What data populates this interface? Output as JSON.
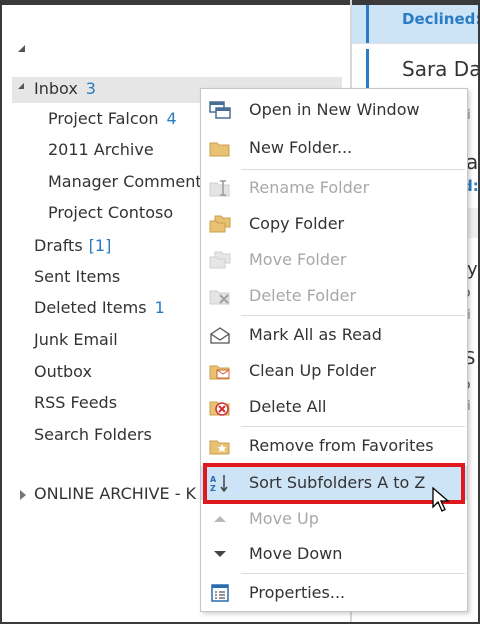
{
  "folder_pane": {
    "inbox": {
      "label": "Inbox",
      "count": "3"
    },
    "subfolders": [
      {
        "label": "Project Falcon",
        "count": "4"
      },
      {
        "label": "2011 Archive",
        "count": ""
      },
      {
        "label": "Manager Comment",
        "count": ""
      },
      {
        "label": "Project Contoso",
        "count": ""
      }
    ],
    "folders": [
      {
        "label": "Drafts",
        "count": "[1]"
      },
      {
        "label": "Sent Items",
        "count": ""
      },
      {
        "label": "Deleted Items",
        "count": "1"
      },
      {
        "label": "Junk Email",
        "count": ""
      },
      {
        "label": "Outbox",
        "count": ""
      },
      {
        "label": "RSS Feeds",
        "count": ""
      },
      {
        "label": "Search Folders",
        "count": ""
      }
    ],
    "archive": {
      "label": "ONLINE ARCHIVE - K"
    }
  },
  "message_pane": {
    "items": [
      {
        "status": "Declined:"
      },
      {
        "sender": "Sara Da",
        "snippet": "ti"
      },
      {
        "sender": "a",
        "status": "d:"
      },
      {
        "sender": "ly",
        "snippet": "o"
      },
      {
        "snippet": "ti"
      },
      {
        "sender": "S",
        "snippet": "o"
      },
      {
        "snippet": "ti"
      }
    ]
  },
  "context_menu": {
    "items": [
      {
        "label": "Open in New Window",
        "icon": "open-window-icon",
        "disabled": false
      },
      {
        "label": "New Folder...",
        "icon": "new-folder-icon",
        "disabled": false
      },
      {
        "label": "Rename Folder",
        "icon": "rename-folder-icon",
        "disabled": true
      },
      {
        "label": "Copy Folder",
        "icon": "copy-folder-icon",
        "disabled": false
      },
      {
        "label": "Move Folder",
        "icon": "move-folder-icon",
        "disabled": true
      },
      {
        "label": "Delete Folder",
        "icon": "delete-folder-icon",
        "disabled": true
      },
      {
        "label": "Mark All as Read",
        "icon": "mark-read-icon",
        "disabled": false
      },
      {
        "label": "Clean Up Folder",
        "icon": "clean-up-icon",
        "disabled": false
      },
      {
        "label": "Delete All",
        "icon": "delete-all-icon",
        "disabled": false
      },
      {
        "label": "Remove from Favorites",
        "icon": "favorites-star-icon",
        "disabled": false
      },
      {
        "label": "Sort Subfolders A to Z",
        "icon": "sort-az-icon",
        "disabled": false,
        "highlighted": true
      },
      {
        "label": "Move Up",
        "icon": "move-up-icon",
        "disabled": true
      },
      {
        "label": "Move Down",
        "icon": "move-down-icon",
        "disabled": false
      },
      {
        "label": "Properties...",
        "icon": "properties-icon",
        "disabled": false
      }
    ]
  },
  "colors": {
    "accent": "#2a7bc4",
    "highlight": "#cde4f7",
    "callout_red": "#e0191f",
    "disabled_text": "#a8a8a8"
  }
}
